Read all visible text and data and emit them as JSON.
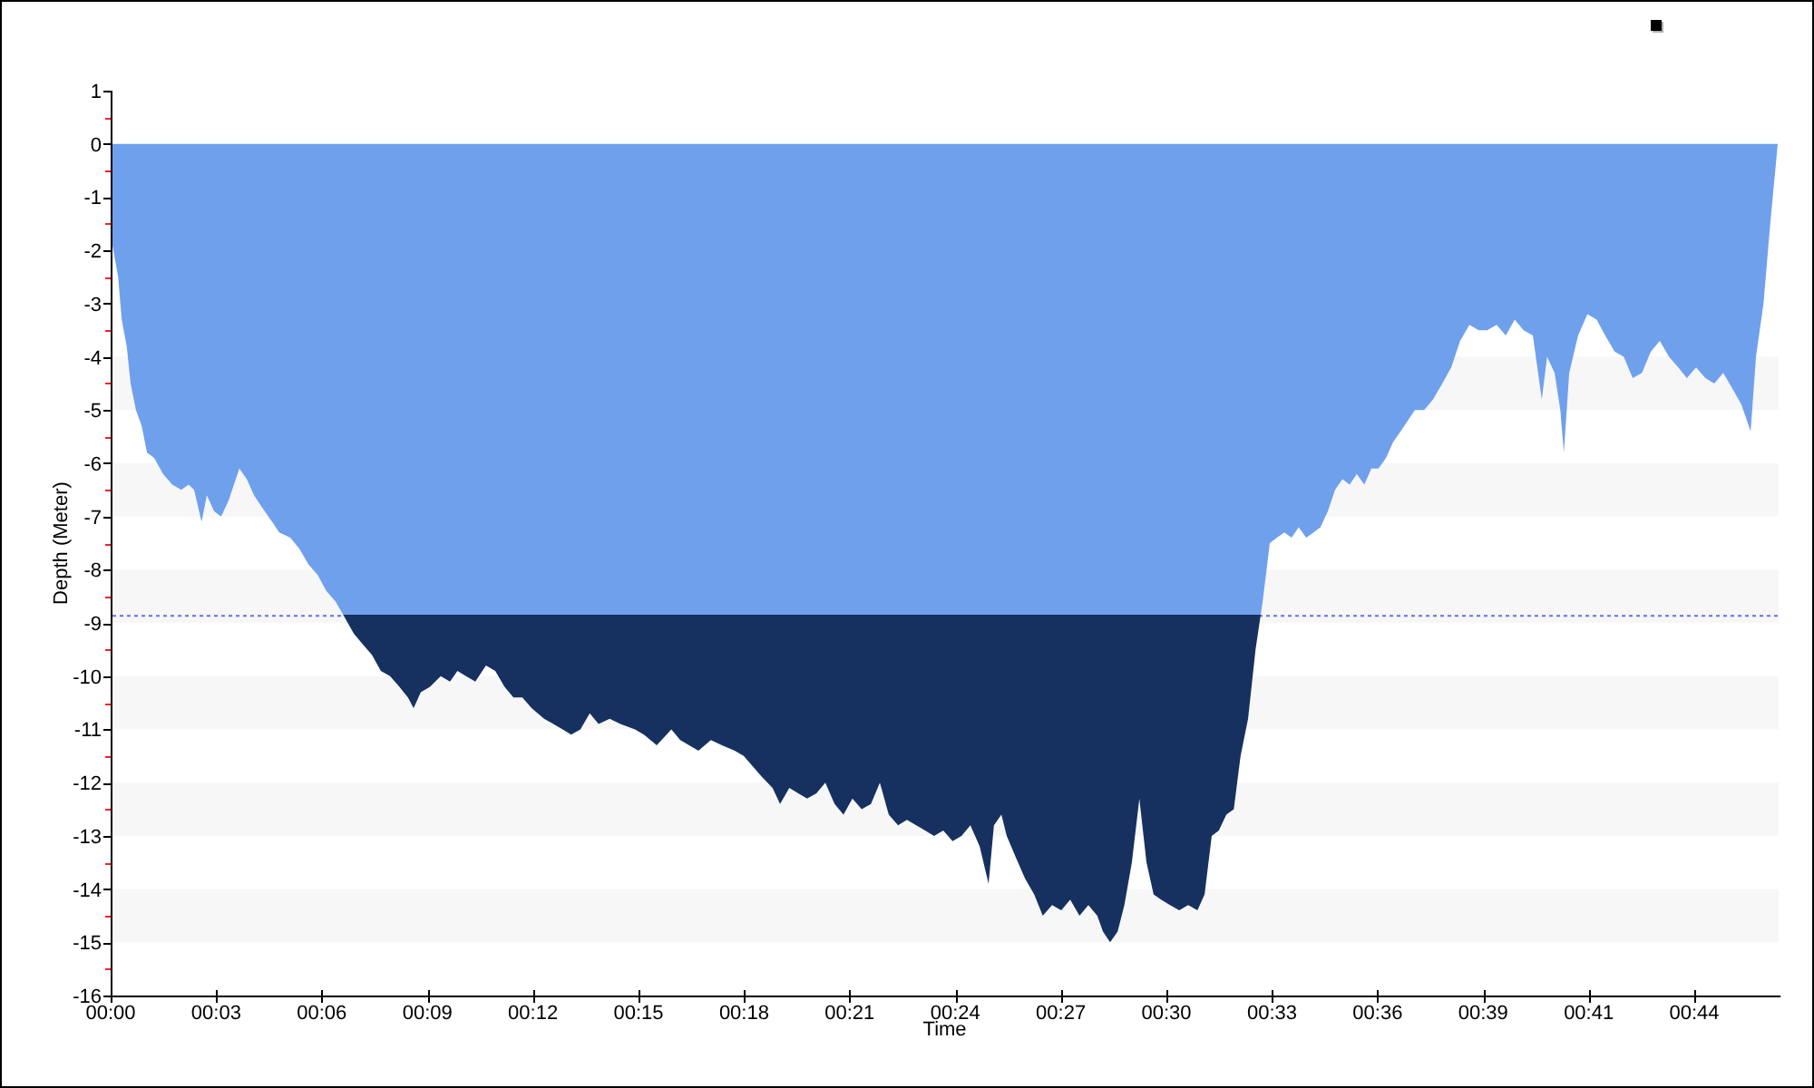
{
  "chart_panel": {
    "chart_data": {
      "type": "area",
      "xlabel": "Time",
      "ylabel": "Depth (Meter)",
      "x": [
        0,
        0.05,
        0.21,
        0.31,
        0.45,
        0.56,
        0.71,
        0.87,
        1.02,
        1.22,
        1.47,
        1.73,
        1.98,
        2.19,
        2.34,
        2.55,
        2.7,
        2.9,
        3.1,
        3.31,
        3.61,
        3.82,
        4.02,
        4.32,
        4.53,
        4.73,
        5.04,
        5.29,
        5.55,
        5.81,
        6.05,
        6.31,
        6.57,
        6.82,
        7.07,
        7.33,
        7.58,
        7.84,
        8.1,
        8.34,
        8.5,
        8.7,
        8.96,
        9.26,
        9.52,
        9.73,
        9.97,
        10.23,
        10.53,
        10.79,
        11.05,
        11.3,
        11.55,
        11.81,
        12.16,
        12.42,
        12.68,
        12.92,
        13.18,
        13.44,
        13.69,
        14.0,
        14.3,
        14.71,
        14.96,
        15.32,
        15.73,
        15.98,
        16.23,
        16.49,
        16.84,
        17.15,
        17.51,
        17.76,
        18.02,
        18.28,
        18.57,
        18.78,
        19.04,
        19.29,
        19.54,
        19.8,
        20.05,
        20.31,
        20.56,
        20.81,
        21.07,
        21.33,
        21.58,
        21.83,
        22.09,
        22.34,
        22.6,
        22.85,
        23.1,
        23.36,
        23.62,
        23.87,
        24.12,
        24.38,
        24.63,
        24.78,
        24.99,
        25.14,
        25.39,
        25.65,
        25.91,
        26.15,
        26.41,
        26.67,
        26.92,
        27.18,
        27.43,
        27.68,
        27.84,
        28.04,
        28.25,
        28.44,
        28.65,
        28.86,
        29.06,
        29.26,
        29.47,
        29.72,
        29.98,
        30.23,
        30.49,
        30.69,
        30.89,
        31.09,
        31.3,
        31.51,
        31.7,
        31.91,
        32.12,
        32.32,
        32.52,
        32.72,
        32.93,
        33.13,
        33.33,
        33.54,
        33.75,
        33.94,
        34.15,
        34.35,
        34.56,
        34.76,
        34.96,
        35.17,
        35.37,
        35.57,
        35.78,
        35.98,
        36.19,
        36.39,
        36.59,
        36.85,
        37.1,
        37.36,
        37.61,
        37.86,
        38.12,
        38.38,
        38.62,
        38.88,
        39.14,
        39.39,
        39.64,
        39.9,
        40.15,
        40.3,
        40.51,
        40.67,
        40.77,
        40.92,
        41.17,
        41.43,
        41.69,
        41.93,
        42.19,
        42.45,
        42.7,
        42.96,
        43.21,
        43.46,
        43.72,
        43.98,
        44.22,
        44.48,
        44.74,
        44.99,
        45.24,
        45.5,
        45.75,
        46.01,
        46.16,
        46.37,
        46.56,
        46.77
      ],
      "series": [
        {
          "color": "#6fa0ec",
          "values": [
            0,
            -1.9,
            -2.5,
            -3.3,
            -3.8,
            -4.5,
            -5.0,
            -5.3,
            -5.8,
            -5.9,
            -6.2,
            -6.4,
            -6.5,
            -6.4,
            -6.5,
            -7.1,
            -6.6,
            -6.9,
            -7.0,
            -6.7,
            -6.1,
            -6.3,
            -6.6,
            -6.9,
            -7.1,
            -7.3,
            -7.4,
            -7.6,
            -7.9,
            -8.1,
            -8.4,
            -8.6,
            -8.9,
            -9.2,
            -9.4,
            -9.6,
            -9.9,
            -10.0,
            -10.2,
            -10.4,
            -10.6,
            -10.3,
            -10.2,
            -10.0,
            -10.1,
            -9.9,
            -10.0,
            -10.1,
            -9.8,
            -9.9,
            -10.2,
            -10.4,
            -10.4,
            -10.6,
            -10.8,
            -10.9,
            -11.0,
            -11.1,
            -11.0,
            -10.7,
            -10.9,
            -10.8,
            -10.9,
            -11.0,
            -11.1,
            -11.3,
            -11.0,
            -11.2,
            -11.3,
            -11.4,
            -11.2,
            -11.3,
            -11.4,
            -11.5,
            -11.7,
            -11.9,
            -12.1,
            -12.4,
            -12.1,
            -12.2,
            -12.3,
            -12.2,
            -12.0,
            -12.4,
            -12.6,
            -12.3,
            -12.5,
            -12.4,
            -12.0,
            -12.6,
            -12.8,
            -12.7,
            -12.8,
            -12.9,
            -13.0,
            -12.9,
            -13.1,
            -13.0,
            -12.8,
            -13.2,
            -13.9,
            -12.8,
            -12.6,
            -13.0,
            -13.4,
            -13.8,
            -14.1,
            -14.5,
            -14.3,
            -14.4,
            -14.2,
            -14.5,
            -14.3,
            -14.5,
            -14.8,
            -15.0,
            -14.8,
            -14.3,
            -13.5,
            -12.3,
            -13.5,
            -14.1,
            -14.2,
            -14.3,
            -14.4,
            -14.3,
            -14.4,
            -14.1,
            -13.0,
            -12.9,
            -12.6,
            -12.5,
            -11.5,
            -10.8,
            -9.5,
            -8.6,
            -7.5,
            -7.4,
            -7.3,
            -7.4,
            -7.2,
            -7.4,
            -7.3,
            -7.2,
            -6.9,
            -6.5,
            -6.3,
            -6.4,
            -6.2,
            -6.4,
            -6.1,
            -6.1,
            -5.9,
            -5.6,
            -5.4,
            -5.2,
            -5.0,
            -5.0,
            -4.8,
            -4.5,
            -4.2,
            -3.7,
            -3.4,
            -3.5,
            -3.5,
            -3.4,
            -3.6,
            -3.3,
            -3.5,
            -3.6,
            -4.8,
            -4.0,
            -4.3,
            -5.0,
            -5.8,
            -4.3,
            -3.6,
            -3.2,
            -3.3,
            -3.6,
            -3.9,
            -4.0,
            -4.4,
            -4.3,
            -3.9,
            -3.7,
            -4.0,
            -4.2,
            -4.4,
            -4.2,
            -4.4,
            -4.5,
            -4.3,
            -4.6,
            -4.9,
            -5.4,
            -4.0,
            -3.0,
            -1.5,
            0
          ]
        }
      ],
      "xlim": [
        0,
        46.8
      ],
      "ylim": [
        -16,
        1
      ],
      "xticks": [
        {
          "value": 0,
          "label": "00:00"
        },
        {
          "value": 2.962,
          "label": "00:03"
        },
        {
          "value": 5.924,
          "label": "00:06"
        },
        {
          "value": 8.886,
          "label": "00:09"
        },
        {
          "value": 11.848,
          "label": "00:12"
        },
        {
          "value": 14.81,
          "label": "00:15"
        },
        {
          "value": 17.772,
          "label": "00:18"
        },
        {
          "value": 20.734,
          "label": "00:21"
        },
        {
          "value": 23.696,
          "label": "00:24"
        },
        {
          "value": 26.658,
          "label": "00:27"
        },
        {
          "value": 29.62,
          "label": "00:30"
        },
        {
          "value": 32.582,
          "label": "00:33"
        },
        {
          "value": 35.544,
          "label": "00:36"
        },
        {
          "value": 38.506,
          "label": "00:39"
        },
        {
          "value": 41.468,
          "label": "00:41"
        },
        {
          "value": 44.43,
          "label": "00:44"
        }
      ],
      "yticks": [
        1,
        0,
        -1,
        -2,
        -3,
        -4,
        -5,
        -6,
        -7,
        -8,
        -9,
        -10,
        -11,
        -12,
        -13,
        -14,
        -15,
        -16
      ],
      "ref_lines": [
        {
          "axis": "y",
          "value": -8.85
        }
      ]
    }
  }
}
